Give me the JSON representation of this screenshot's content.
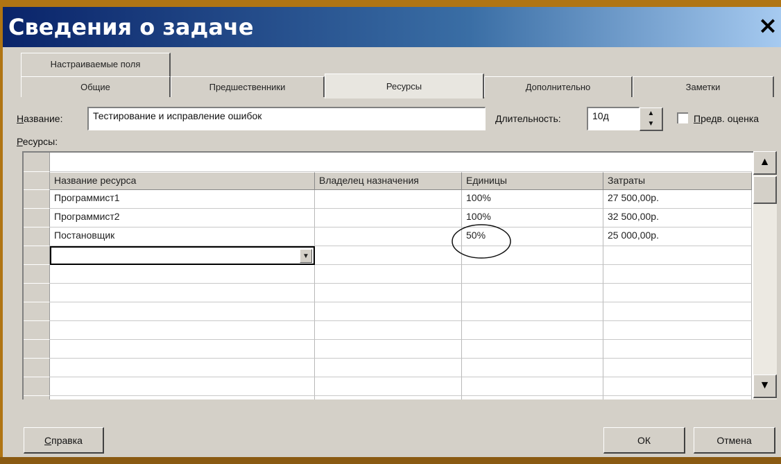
{
  "window": {
    "title": "Сведения о задаче",
    "close_label": "×"
  },
  "tabs": {
    "row_top": [
      "Настраиваемые поля"
    ],
    "row_bottom": [
      "Общие",
      "Предшественники",
      "Ресурсы",
      "Дополнительно",
      "Заметки"
    ],
    "active": "Ресурсы"
  },
  "form": {
    "name_label": "Название:",
    "name_value": "Тестирование и исправление ошибок",
    "duration_label": "Длительность:",
    "duration_value": "10д",
    "estimate_label": "Предв. оценка",
    "resources_label": "Ресурсы:"
  },
  "table": {
    "headers": [
      "Название ресурса",
      "Владелец назначения",
      "Единицы",
      "Затраты"
    ],
    "rows": [
      [
        "Программист1",
        "",
        "100%",
        "27 500,00р."
      ],
      [
        "Программист2",
        "",
        "100%",
        "32 500,00р."
      ],
      [
        "Постановщик",
        "",
        "50%",
        "25 000,00р."
      ]
    ]
  },
  "buttons": {
    "help": "Справка",
    "ok": "ОК",
    "cancel": "Отмена"
  }
}
